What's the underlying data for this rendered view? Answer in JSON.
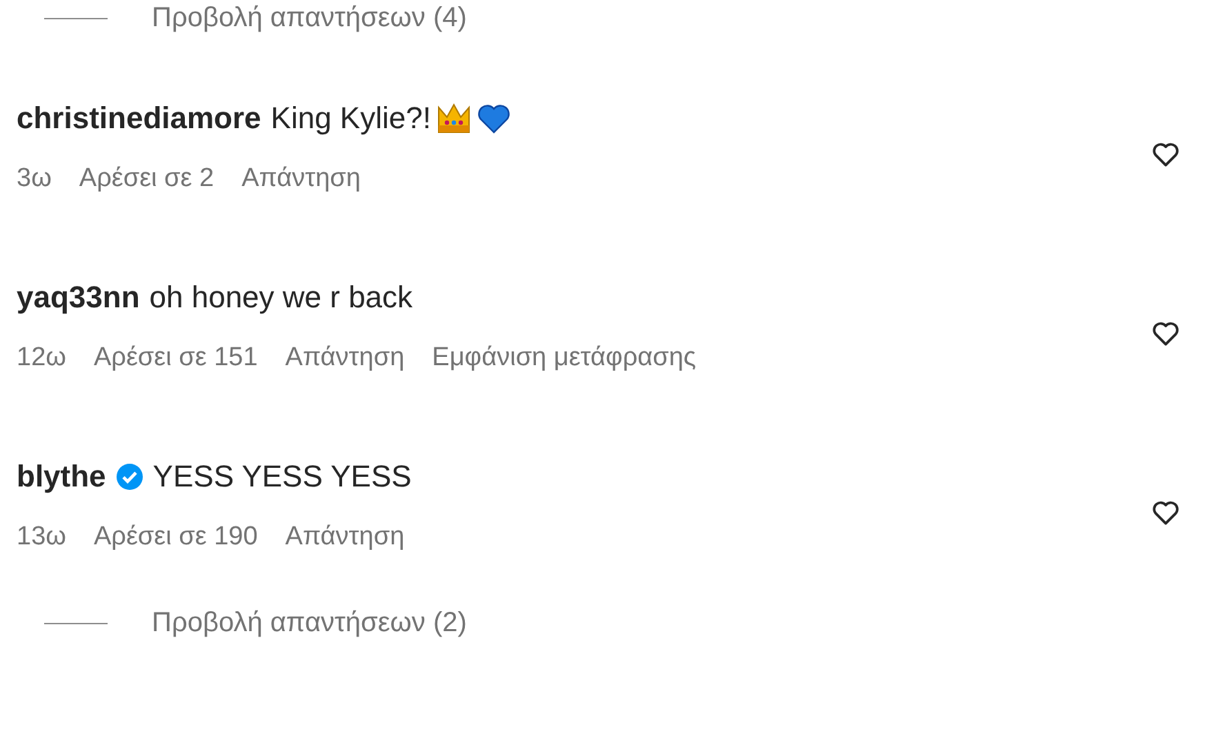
{
  "top_replies_link": {
    "label": "Προβολή απαντήσεων (4)"
  },
  "comments": [
    {
      "username": "christinediamore",
      "verified": false,
      "kind": "with-emoji",
      "text": "King Kylie?!",
      "liked": false,
      "meta": [
        "3ω",
        "Αρέσει σε 2",
        "Απάντηση"
      ]
    },
    {
      "username": "yaq33nn",
      "verified": false,
      "kind": "plain",
      "text": "oh honey we r back",
      "liked": false,
      "meta": [
        "12ω",
        "Αρέσει σε 151",
        "Απάντηση",
        "Εμφάνιση μετάφρασης"
      ]
    },
    {
      "username": "blythe",
      "verified": true,
      "kind": "plain",
      "text": "YESS YESS YESS",
      "liked": false,
      "meta": [
        "13ω",
        "Αρέσει σε 190",
        "Απάντηση"
      ]
    }
  ],
  "bottom_replies_link": {
    "label": "Προβολή απαντήσεων (2)"
  }
}
